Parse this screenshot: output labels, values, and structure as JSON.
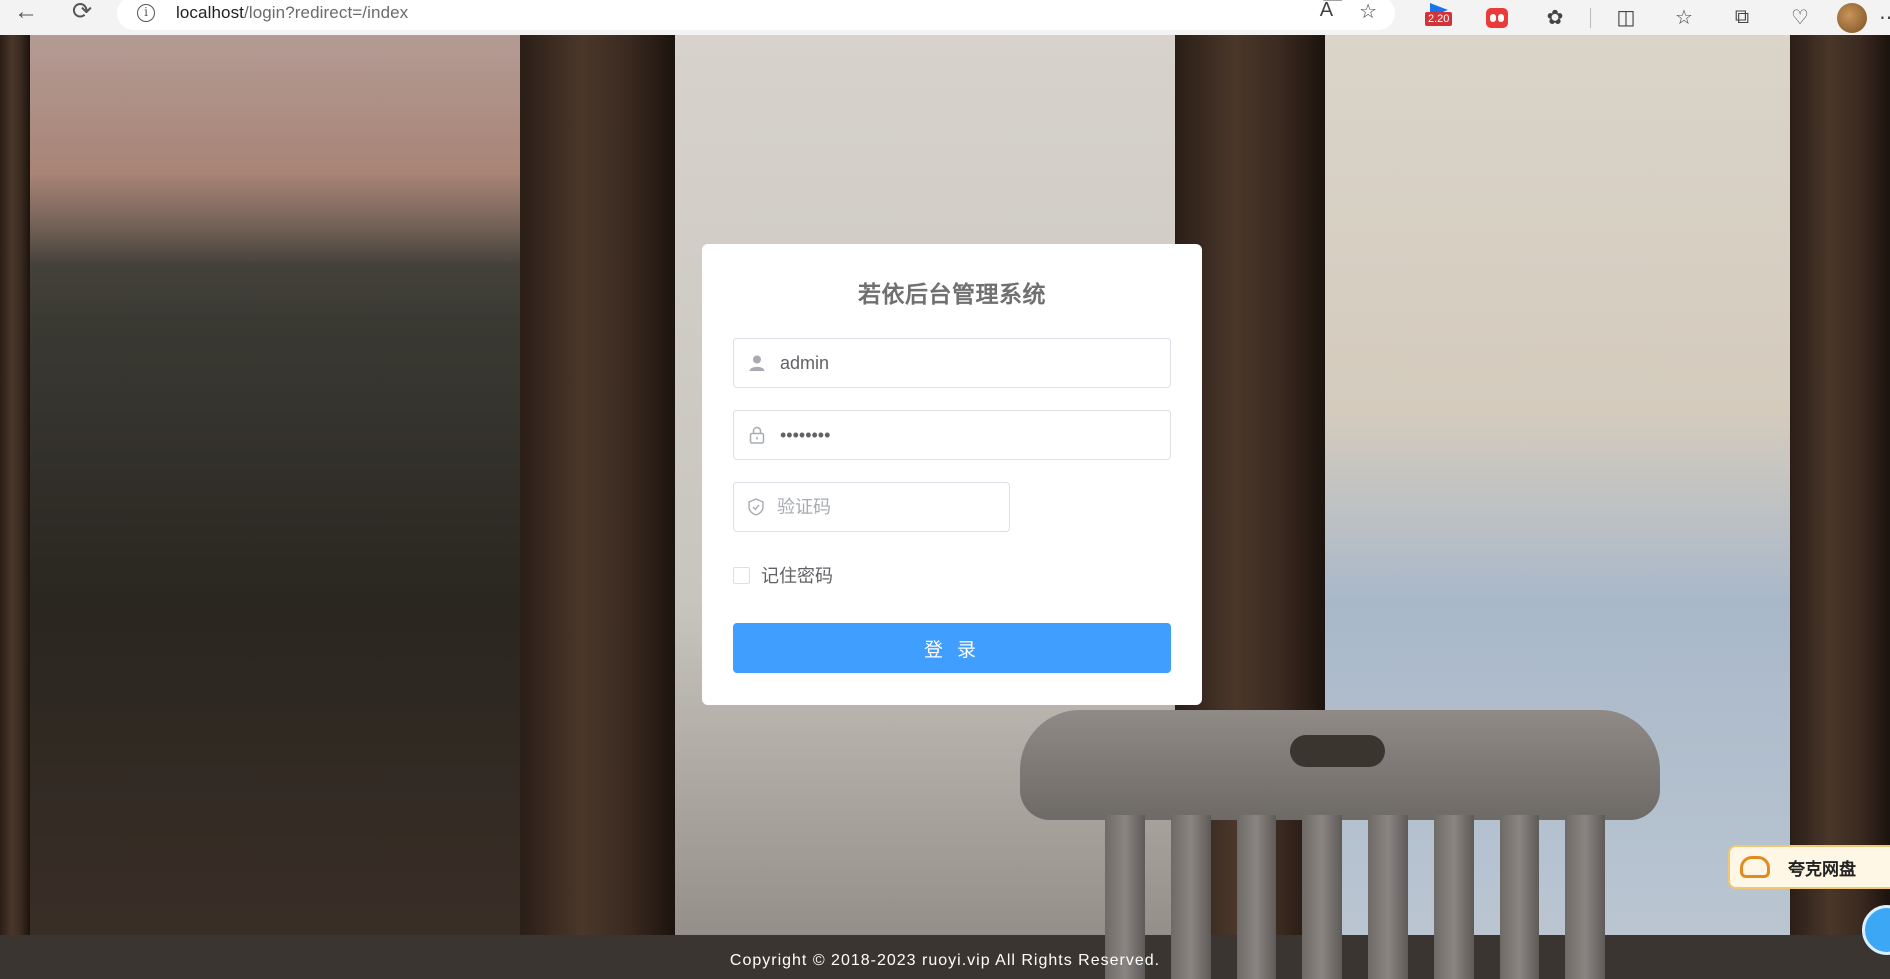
{
  "browser": {
    "url_host": "localhost",
    "url_path": "/login?redirect=/index",
    "ext_badge": "2.20"
  },
  "login": {
    "title": "若依后台管理系统",
    "username_value": "admin",
    "password_value": "••••••••",
    "code_placeholder": "验证码",
    "remember_label": "记住密码",
    "login_button": "登 录"
  },
  "footer": {
    "copyright": "Copyright © 2018-2023 ruoyi.vip All Rights Reserved."
  },
  "widgets": {
    "quark_label": "夸克网盘"
  },
  "colors": {
    "primary": "#409eff",
    "card": "#ffffff",
    "text_muted": "#707070"
  }
}
